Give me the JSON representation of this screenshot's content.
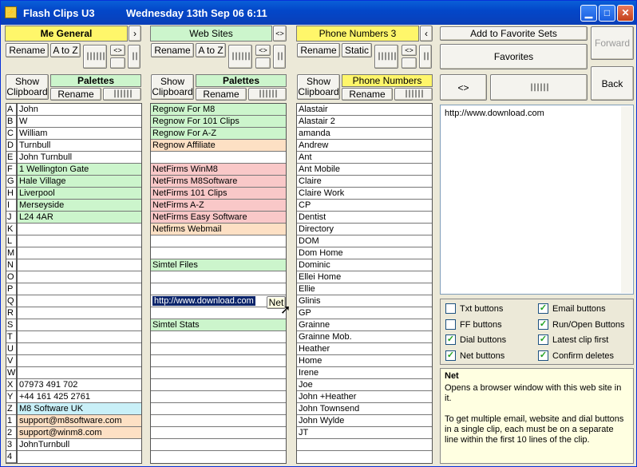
{
  "title": {
    "app": "Flash Clips U3",
    "clock": "Wednesday  13th Sep 06   6:11"
  },
  "col1": {
    "header": "Me General",
    "rename": "Rename",
    "sort": "A to Z",
    "show": "Show Clipboard",
    "palettes": "Palettes",
    "pal_rename": "Rename"
  },
  "col2": {
    "header": "Web Sites",
    "rename": "Rename",
    "sort": "A to Z",
    "show": "Show Clipboard",
    "palettes": "Palettes",
    "pal_rename": "Rename"
  },
  "col3": {
    "header": "Phone Numbers 3",
    "rename": "Rename",
    "sort": "Static",
    "show": "Show Clipboard",
    "palettes": "Phone Numbers",
    "pal_rename": "Rename"
  },
  "right": {
    "add_fav": "Add to Favorite Sets",
    "forward": "Forward",
    "favorites": "Favorites",
    "swap": "<>",
    "back": "Back"
  },
  "letters": [
    "A",
    "B",
    "C",
    "D",
    "E",
    "F",
    "G",
    "H",
    "I",
    "J",
    "K",
    "L",
    "M",
    "N",
    "O",
    "P",
    "Q",
    "R",
    "S",
    "T",
    "U",
    "V",
    "W",
    "X",
    "Y",
    "Z",
    "1",
    "2",
    "3",
    "4"
  ],
  "list1": [
    "John",
    "W",
    "William",
    "Turnbull",
    "John Turnbull",
    "1 Wellington Gate",
    "Hale Village",
    "Liverpool",
    "Merseyside",
    "L24 4AR",
    "",
    "",
    "",
    "",
    "",
    "",
    "",
    "",
    "",
    "",
    "",
    "",
    "",
    "07973 491 702",
    "+44 161 425 2761",
    "M8 Software UK",
    "support@m8software.com",
    "support@winm8.com",
    "JohnTurnbull",
    ""
  ],
  "list2": [
    "Regnow For M8",
    "Regnow For 101 Clips",
    "Regnow For A-Z",
    "Regnow Affiliate",
    "",
    "NetFirms WinM8",
    "NetFirms M8Software",
    "NetFirms 101 Clips",
    "NetFirms A-Z",
    "NetFirms Easy Software",
    "Netfirms Webmail",
    "",
    "",
    "Simtel Files",
    "",
    "",
    "http://www.download.com",
    "",
    "Simtel Stats",
    "",
    "",
    "",
    "",
    "",
    "",
    "",
    "",
    "",
    "",
    ""
  ],
  "list3": [
    "Alastair",
    "Alastair 2",
    "amanda",
    "Andrew",
    "Ant",
    "Ant Mobile",
    "Claire",
    "Claire Work",
    "CP",
    "Dentist",
    "Directory",
    "DOM",
    "Dom Home",
    "Dominic",
    "Ellei Home",
    "Ellie",
    "Glinis",
    "GP",
    "Grainne",
    "Grainne Mob.",
    "Heather",
    "Home",
    "Irene",
    "Joe",
    "John +Heather",
    "John Townsend",
    "John Wylde",
    "JT",
    "",
    ""
  ],
  "net_btn": "Net",
  "clip_text": "http://www.download.com",
  "options": [
    {
      "label": "Txt buttons",
      "checked": false
    },
    {
      "label": "Email buttons",
      "checked": true
    },
    {
      "label": "FF buttons",
      "checked": false
    },
    {
      "label": "Run/Open Buttons",
      "checked": true
    },
    {
      "label": "Dial buttons",
      "checked": true
    },
    {
      "label": "Latest clip first",
      "checked": true
    },
    {
      "label": "Net buttons",
      "checked": true
    },
    {
      "label": "Confirm deletes",
      "checked": true
    }
  ],
  "help": {
    "title": "Net",
    "p1": "Opens a browser window with this web site in it.",
    "p2": "To get multiple email, website and dial buttons in a single clip, each must be on a separate line within the first 10 lines of the clip."
  },
  "colors": {
    "green": "#ccf5cc",
    "orange": "#fde0c4",
    "pink": "#f9c8c8",
    "cyan": "#c9f0f8",
    "yellow": "#fff66a"
  }
}
